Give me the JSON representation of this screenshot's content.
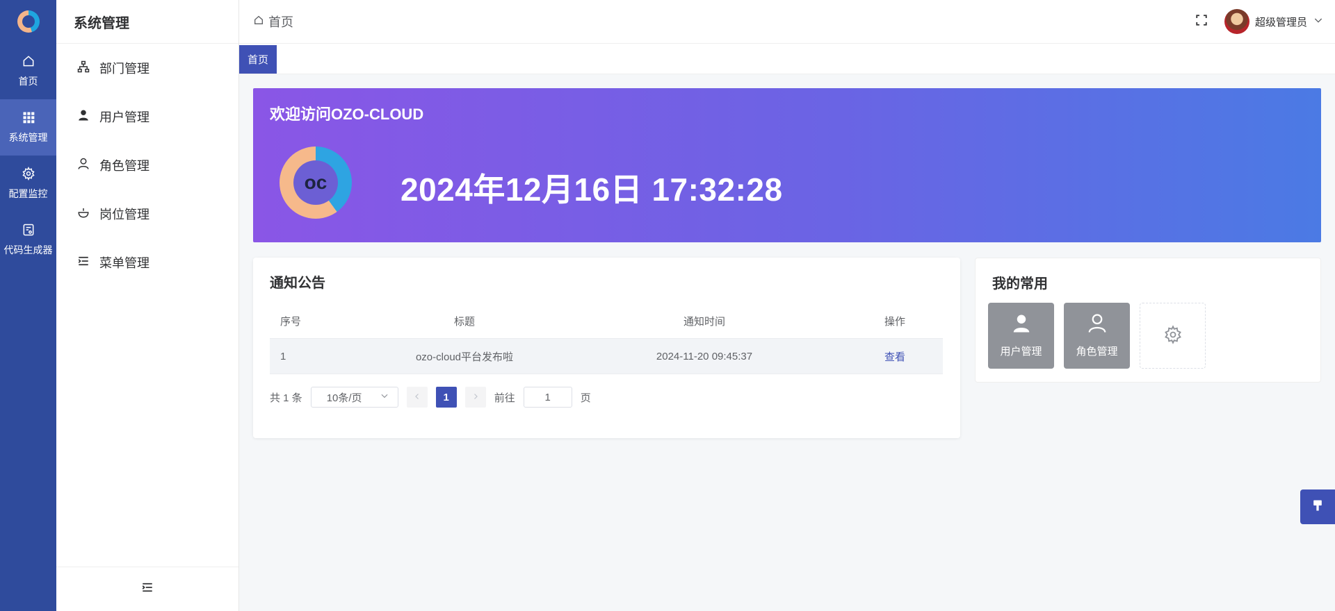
{
  "sidebar": {
    "items": [
      {
        "label": "首页",
        "icon": "home-icon"
      },
      {
        "label": "系统管理",
        "icon": "grid-icon"
      },
      {
        "label": "配置监控",
        "icon": "gear-icon"
      },
      {
        "label": "代码生成器",
        "icon": "code-generator-icon"
      }
    ]
  },
  "submenu": {
    "title": "系统管理",
    "items": [
      {
        "label": "部门管理",
        "icon": "org-chart-icon"
      },
      {
        "label": "用户管理",
        "icon": "user-solid-icon"
      },
      {
        "label": "角色管理",
        "icon": "user-outline-icon"
      },
      {
        "label": "岗位管理",
        "icon": "post-icon"
      },
      {
        "label": "菜单管理",
        "icon": "menu-list-icon"
      }
    ]
  },
  "header": {
    "breadcrumb": "首页",
    "username": "超级管理员"
  },
  "tabs": [
    {
      "label": "首页",
      "active": true
    }
  ],
  "banner": {
    "title": "欢迎访问OZO-CLOUD",
    "logo_text": "oc",
    "datetime": "2024年12月16日 17:32:28"
  },
  "notice": {
    "title": "通知公告",
    "columns": [
      "序号",
      "标题",
      "通知时间",
      "操作"
    ],
    "rows": [
      {
        "index": "1",
        "title": "ozo-cloud平台发布啦",
        "time": "2024-11-20 09:45:37",
        "action": "查看"
      }
    ],
    "pagination": {
      "total": "共 1 条",
      "page_size": "10条/页",
      "current": "1",
      "goto_label": "前往",
      "goto_value": "1",
      "page_unit": "页"
    }
  },
  "favorites": {
    "title": "我的常用",
    "items": [
      {
        "label": "用户管理",
        "icon": "user-solid-icon"
      },
      {
        "label": "角色管理",
        "icon": "user-outline-icon"
      }
    ]
  },
  "colors": {
    "rail": "#2f4b9c",
    "accent": "#3f51b5",
    "banner_start": "#8a56e6",
    "banner_end": "#4b7ae4"
  }
}
